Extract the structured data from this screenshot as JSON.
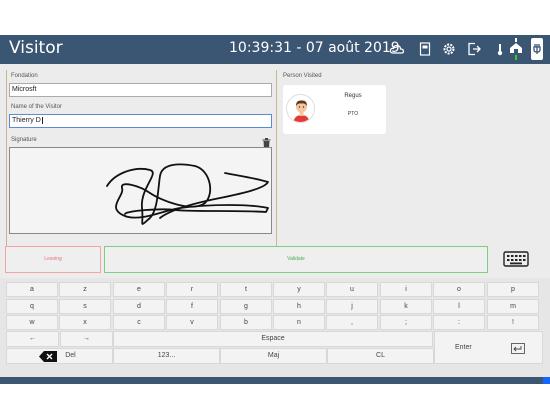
{
  "header": {
    "title": "Visitor",
    "datetime": "10:39:31 - 07 août 2019",
    "icons": [
      "cloud-icon",
      "document-icon",
      "gear-icon",
      "logout-icon",
      "thermometer-icon",
      "home-status-icon",
      "power-plug-icon"
    ]
  },
  "form": {
    "foundation_label": "Fondation",
    "foundation_value": "Microsft",
    "visitor_label": "Name of the Visitor",
    "visitor_value": "Thierry D",
    "signature_label": "Signature"
  },
  "person": {
    "section_label": "Person Visited",
    "name": "Regus",
    "role": "PTO"
  },
  "actions": {
    "leaving": "Leaving",
    "validate": "Validate"
  },
  "keyboard": {
    "row1": [
      "a",
      "z",
      "e",
      "r",
      "t",
      "y",
      "u",
      "i",
      "o",
      "p"
    ],
    "row2": [
      "q",
      "s",
      "d",
      "f",
      "g",
      "h",
      "j",
      "k",
      "l",
      "m"
    ],
    "row3": [
      "w",
      "x",
      "c",
      "v",
      "b",
      "n",
      ",",
      ";",
      ":",
      "!"
    ],
    "arrow_left": "←",
    "arrow_right": "→",
    "space": "Espace",
    "del": "Del",
    "numbers": "123...",
    "shift": "Maj",
    "clear": "CL",
    "enter": "Enter"
  },
  "colors": {
    "header_bg": "#3b5673",
    "leaving": "#e57373",
    "validate": "#4caf50",
    "accent": "#1565ff"
  }
}
